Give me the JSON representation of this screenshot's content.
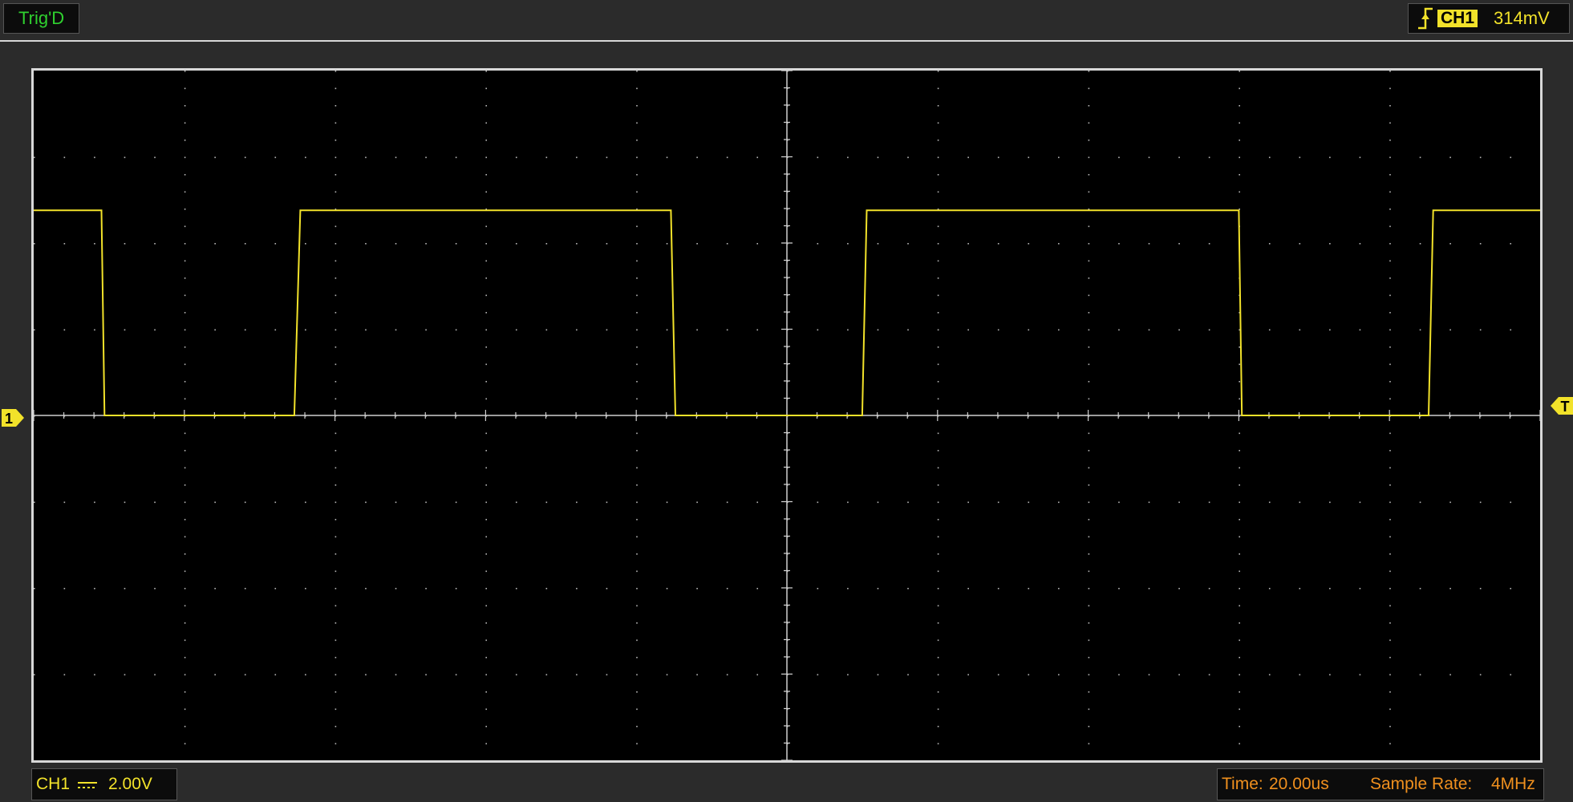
{
  "top_bar": {
    "trigger_status": "Trig'D",
    "trigger_channel": "CH1",
    "trigger_level": "314mV",
    "trigger_edge_icon": "rising-edge-icon"
  },
  "markers": {
    "channel_marker": "1",
    "trigger_marker": "T"
  },
  "bottom_bar": {
    "channel": "CH1",
    "coupling_icon": "dc-coupling-icon",
    "volts_per_div": "2.00V",
    "time_label": "Time:",
    "time_per_div": "20.00us",
    "sample_rate_label": "Sample Rate:",
    "sample_rate": "4MHz"
  },
  "colors": {
    "trace": "#f2e22a",
    "trigger_status": "#2fd12f",
    "time_text": "#f0901e",
    "background": "#000000",
    "grid": "#b4b4b4"
  },
  "chart_data": {
    "type": "line",
    "x_divisions": 10,
    "y_divisions": 8,
    "trace_color": "#f2e22a",
    "series": [
      {
        "x": [
          -5.0,
          -4.55,
          -4.53,
          -3.27,
          -3.23,
          -0.77,
          -0.74,
          0.5,
          0.53,
          3.0,
          3.02,
          4.26,
          4.29,
          5.0
        ],
        "y": [
          2.38,
          2.38,
          0.0,
          0.0,
          2.38,
          2.38,
          0.0,
          0.0,
          2.38,
          2.38,
          0.0,
          0.0,
          2.38,
          2.38
        ]
      }
    ]
  }
}
